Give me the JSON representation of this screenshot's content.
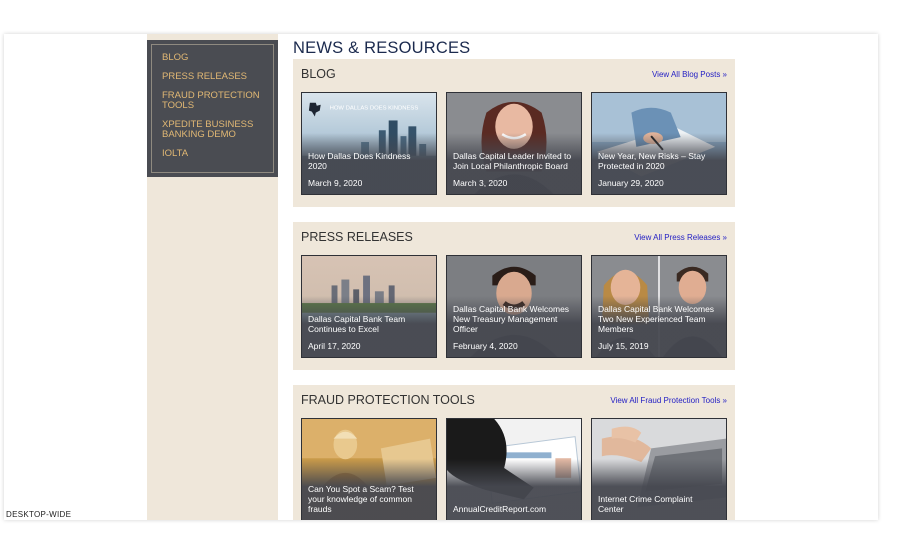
{
  "sidebar": {
    "items": [
      {
        "label": "BLOG"
      },
      {
        "label": "PRESS RELEASES"
      },
      {
        "label": "FRAUD PROTECTION TOOLS"
      },
      {
        "label": "XPEDITE BUSINESS BANKING DEMO"
      },
      {
        "label": "IOLTA"
      }
    ]
  },
  "page_title": "NEWS & RESOURCES",
  "sections": [
    {
      "heading": "BLOG",
      "view_all": "View All Blog Posts »",
      "cards": [
        {
          "title": "How Dallas Does Kindness 2020",
          "date": "March 9, 2020",
          "image_text": "HOW DALLAS DOES KINDNESS"
        },
        {
          "title": "Dallas Capital Leader Invited to Join Local Philanthropic Board",
          "date": "March 3, 2020"
        },
        {
          "title": "New Year, New Risks – Stay Protected in 2020",
          "date": "January 29, 2020"
        }
      ]
    },
    {
      "heading": "PRESS RELEASES",
      "view_all": "View All Press Releases »",
      "cards": [
        {
          "title": "Dallas Capital Bank Team Continues to Excel",
          "date": "April 17, 2020"
        },
        {
          "title": "Dallas Capital Bank Welcomes New Treasury Management Officer",
          "date": "February 4, 2020"
        },
        {
          "title": "Dallas Capital Bank Welcomes Two New Experienced Team Members",
          "date": "July 15, 2019"
        }
      ]
    },
    {
      "heading": "FRAUD PROTECTION TOOLS",
      "view_all": "View All Fraud Protection Tools »",
      "cards": [
        {
          "title": "Can You Spot a Scam? Test your knowledge of common frauds",
          "date": ""
        },
        {
          "title": "AnnualCreditReport.com",
          "date": ""
        },
        {
          "title": "Internet Crime Complaint Center",
          "date": ""
        }
      ]
    }
  ],
  "device_label": "DESKTOP-WIDE",
  "colors": {
    "nav_bg": "#4a4c52",
    "nav_text": "#e1b874",
    "panel_bg": "#efe7da",
    "title": "#1b2a4e",
    "link": "#2420c4"
  }
}
